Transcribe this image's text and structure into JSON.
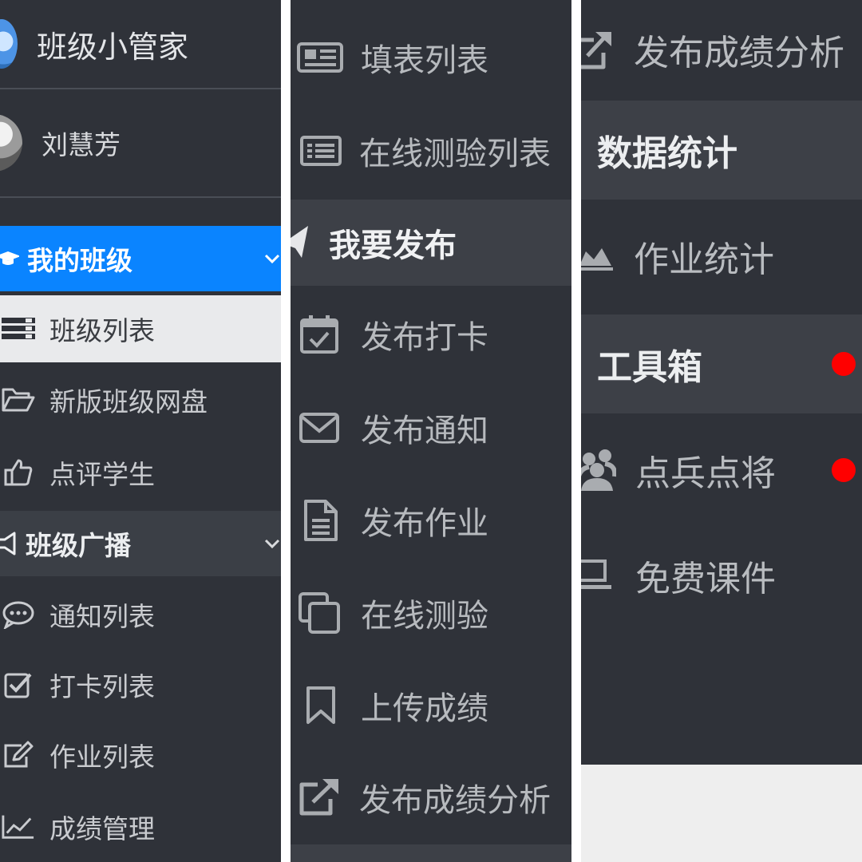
{
  "colors": {
    "panel_bg": "#2f3239",
    "active_blue": "#0a84ff",
    "highlight_bg": "#3d4047",
    "selected_bg": "#e9eaec",
    "badge_red": "#ff0000"
  },
  "left": {
    "brand": {
      "logo_icon": "globe-logo-icon",
      "title": "班级小管家"
    },
    "user": {
      "avatar_icon": "user-avatar",
      "name": "刘慧芳"
    },
    "sections": [
      {
        "label": "我的班级",
        "icon": "graduation-cap-icon",
        "state": "active",
        "chevron": "chevron-down-icon"
      },
      {
        "label": "班级列表",
        "icon": "list-icon",
        "state": "selected"
      },
      {
        "label": "新版班级网盘",
        "icon": "folder-open-icon"
      },
      {
        "label": "点评学生",
        "icon": "thumbs-up-icon"
      },
      {
        "label": "班级广播",
        "icon": "megaphone-icon",
        "state": "group",
        "chevron": "chevron-down-icon"
      },
      {
        "label": "通知列表",
        "icon": "chat-bubble-icon"
      },
      {
        "label": "打卡列表",
        "icon": "checkbox-icon"
      },
      {
        "label": "作业列表",
        "icon": "edit-icon"
      },
      {
        "label": "成绩管理",
        "icon": "line-chart-icon"
      }
    ]
  },
  "middle": {
    "items": [
      {
        "label": "填表列表",
        "icon": "newspaper-icon"
      },
      {
        "label": "在线测验列表",
        "icon": "list-alt-icon"
      },
      {
        "label": "我要发布",
        "icon": "paper-plane-icon",
        "state": "highlight"
      },
      {
        "label": "发布打卡",
        "icon": "calendar-check-icon"
      },
      {
        "label": "发布通知",
        "icon": "envelope-icon"
      },
      {
        "label": "发布作业",
        "icon": "file-text-icon"
      },
      {
        "label": "在线测验",
        "icon": "copy-icon"
      },
      {
        "label": "上传成绩",
        "icon": "bookmark-icon"
      },
      {
        "label": "发布成绩分析",
        "icon": "external-link-icon"
      }
    ]
  },
  "right": {
    "items": [
      {
        "label": "发布成绩分析",
        "icon": "external-link-icon"
      },
      {
        "label": "数据统计",
        "state": "band"
      },
      {
        "label": "作业统计",
        "icon": "area-chart-icon"
      },
      {
        "label": "工具箱",
        "state": "band",
        "badge": "red-dot"
      },
      {
        "label": "点兵点将",
        "icon": "users-icon",
        "badge": "red-dot"
      },
      {
        "label": "免费课件",
        "icon": "laptop-icon"
      }
    ]
  }
}
